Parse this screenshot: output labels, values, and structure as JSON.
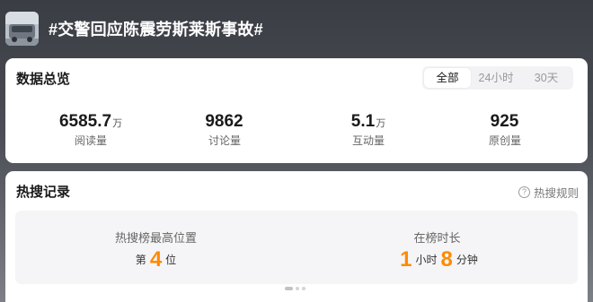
{
  "header": {
    "topic_title": "#交警回应陈震劳斯莱斯事故#",
    "thumbnail_icon": "topic-thumbnail-icon"
  },
  "overview": {
    "title": "数据总览",
    "tabs": [
      {
        "label": "全部",
        "active": true
      },
      {
        "label": "24小时",
        "active": false
      },
      {
        "label": "30天",
        "active": false
      }
    ],
    "stats": [
      {
        "value": "6585.7",
        "unit": "万",
        "label": "阅读量"
      },
      {
        "value": "9862",
        "unit": "",
        "label": "讨论量"
      },
      {
        "value": "5.1",
        "unit": "万",
        "label": "互动量"
      },
      {
        "value": "925",
        "unit": "",
        "label": "原创量"
      }
    ]
  },
  "hot_search": {
    "title": "热搜记录",
    "rule_label": "热搜规则",
    "peak": {
      "label": "热搜榜最高位置",
      "prefix": "第",
      "value": "4",
      "suffix": "位"
    },
    "duration": {
      "label": "在榜时长",
      "hours": "1",
      "hours_unit": "小时",
      "minutes": "8",
      "minutes_unit": "分钟"
    }
  },
  "colors": {
    "accent": "#ff8a00",
    "header_bg": "#3a3d44"
  }
}
